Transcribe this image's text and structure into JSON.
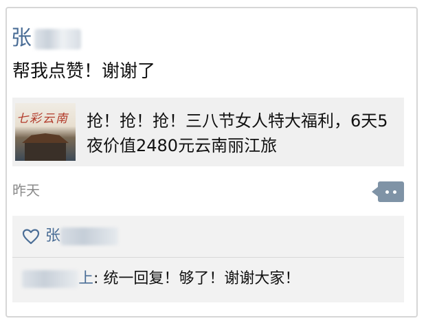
{
  "post": {
    "username_visible": "张",
    "text": "帮我点赞！谢谢了",
    "time": "昨天"
  },
  "link_card": {
    "thumbnail_text": "七彩云南",
    "title": "抢！抢！抢！三八节女人特大福利，6天5夜价值2480元云南丽江旅"
  },
  "likes": {
    "icon": "heart-outline-icon",
    "visible_name": "张"
  },
  "reply": {
    "name_suffix": "上",
    "separator": ": ",
    "text": "统一回复！够了！谢谢大家！"
  },
  "colors": {
    "name_link": "#4a6d96",
    "comment_button": "#7f93a6",
    "feedback_bg": "#f2f2f2"
  }
}
